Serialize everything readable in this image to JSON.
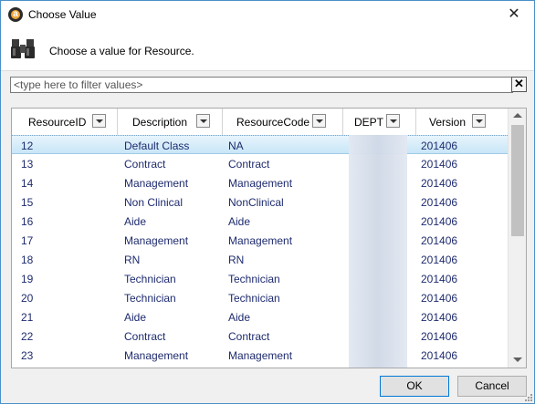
{
  "window": {
    "title": "Choose Value",
    "close_glyph": "✕",
    "app_icon_letter": "a"
  },
  "header": {
    "prompt": "Choose a value for Resource.",
    "icon": "binoculars-icon"
  },
  "filter": {
    "placeholder": "<type here to filter values>",
    "value": "",
    "clear_glyph": "✕"
  },
  "grid": {
    "columns": [
      "ResourceID",
      "Description",
      "ResourceCode",
      "DEPT",
      "Version"
    ],
    "selected_row_index": 0,
    "rows": [
      {
        "id": "12",
        "description": "Default Class",
        "code": "NA",
        "dept": "",
        "version": "201406"
      },
      {
        "id": "13",
        "description": "Contract",
        "code": "Contract",
        "dept": "",
        "version": "201406"
      },
      {
        "id": "14",
        "description": "Management",
        "code": "Management",
        "dept": "",
        "version": "201406"
      },
      {
        "id": "15",
        "description": "Non Clinical",
        "code": "NonClinical",
        "dept": "",
        "version": "201406"
      },
      {
        "id": "16",
        "description": "Aide",
        "code": "Aide",
        "dept": "",
        "version": "201406"
      },
      {
        "id": "17",
        "description": "Management",
        "code": "Management",
        "dept": "",
        "version": "201406"
      },
      {
        "id": "18",
        "description": "RN",
        "code": "RN",
        "dept": "",
        "version": "201406"
      },
      {
        "id": "19",
        "description": "Technician",
        "code": "Technician",
        "dept": "",
        "version": "201406"
      },
      {
        "id": "20",
        "description": "Technician",
        "code": "Technician",
        "dept": "",
        "version": "201406"
      },
      {
        "id": "21",
        "description": "Aide",
        "code": "Aide",
        "dept": "",
        "version": "201406"
      },
      {
        "id": "22",
        "description": "Contract",
        "code": "Contract",
        "dept": "",
        "version": "201406"
      },
      {
        "id": "23",
        "description": "Management",
        "code": "Management",
        "dept": "",
        "version": "201406"
      }
    ]
  },
  "buttons": {
    "ok": "OK",
    "cancel": "Cancel"
  },
  "colors": {
    "accent": "#0078d7",
    "selected_row": "#c8e6f7",
    "cell_text": "#1e2b6e"
  }
}
